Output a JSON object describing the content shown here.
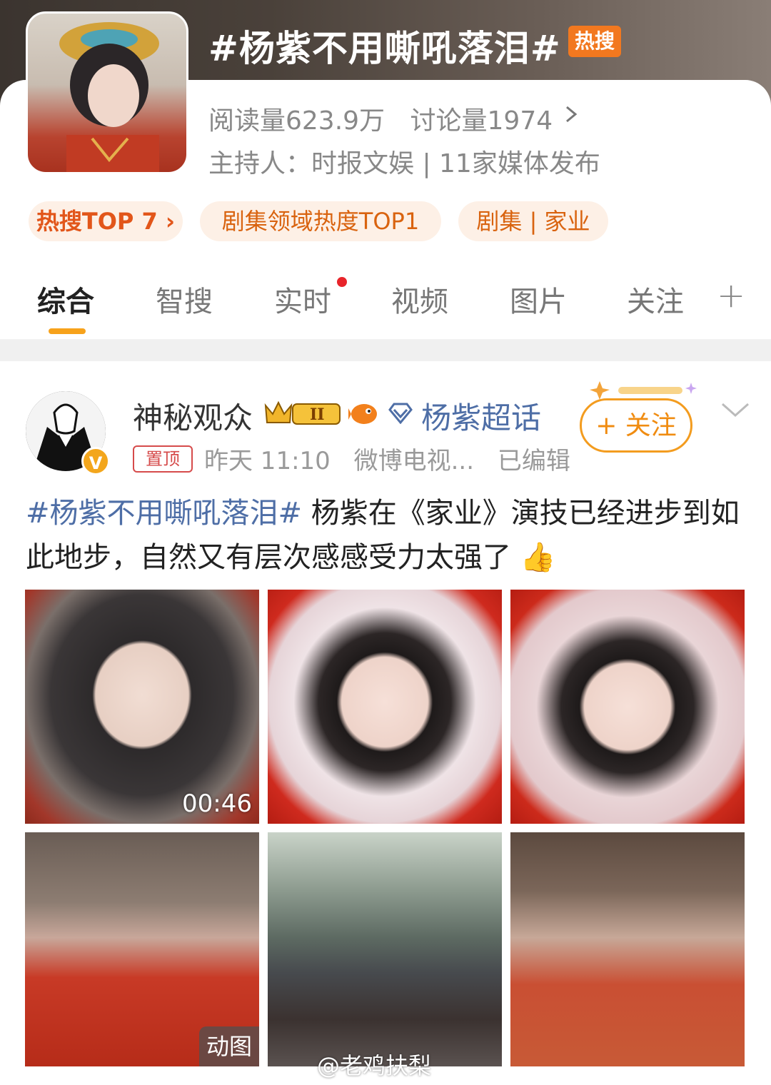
{
  "topic": {
    "title": "#杨紫不用嘶吼落泪#",
    "hot_badge": "热搜",
    "reads": "阅读量623.9万",
    "discussions": "讨论量1974",
    "host": "主持人：时报文娱 | 11家媒体发布",
    "tags": [
      "热搜TOP 7 ›",
      "剧集领域热度TOP1",
      "剧集 | 家业"
    ]
  },
  "tabs": [
    {
      "label": "综合",
      "active": true
    },
    {
      "label": "智搜"
    },
    {
      "label": "实时",
      "has_dot": true
    },
    {
      "label": "视频"
    },
    {
      "label": "图片"
    },
    {
      "label": "关注"
    }
  ],
  "tab_add": "+",
  "post": {
    "username": "神秘观众",
    "level_badge": "II",
    "verify_badge": "V",
    "supertopic": "杨紫超话",
    "pin_label": "置顶",
    "time": "昨天 11:10",
    "source": "微博电视...",
    "edited": "已编辑",
    "follow_label": "+ 关注",
    "text_hashtag": "#杨紫不用嘶吼落泪#",
    "text_body": " 杨紫在《家业》演技已经进步到如此地步，自然又有层次感感受力太强了",
    "emoji": "👍",
    "video_duration": "00:46",
    "gif_label": "动图"
  },
  "watermark": "@老鸡扶梨",
  "colors": {
    "accent": "#f39c1f",
    "link": "#4e6ea6",
    "hot_orange": "#f2781f",
    "tab_underline": "#f7a21b",
    "red_dot": "#e8242a"
  }
}
